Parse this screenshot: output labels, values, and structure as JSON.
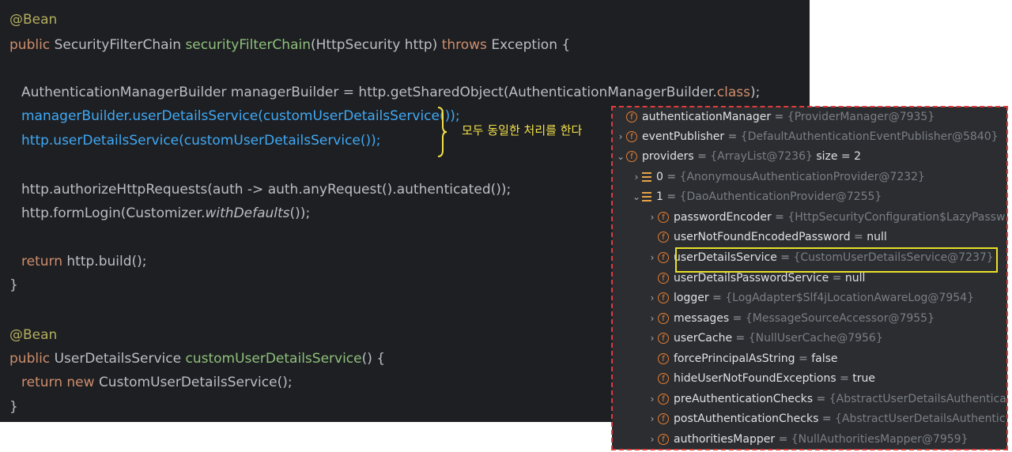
{
  "code": {
    "l1": "@Bean",
    "l2": {
      "kw1": "public",
      "type": "SecurityFilterChain",
      "fn": "securityFilterChain",
      "args": "(HttpSecurity http)",
      "kw2": "throws",
      "rest": "Exception {"
    },
    "l3": {
      "a": "AuthenticationManagerBuilder managerBuilder = http.getSharedObject(AuthenticationManagerBuilder.",
      "kw": "class",
      "b": ");"
    },
    "l4": "managerBuilder.userDetailsService(customUserDetailsService());",
    "l5": "http.userDetailsService(customUserDetailsService());",
    "l6": "http.authorizeHttpRequests(auth -> auth.anyRequest().authenticated());",
    "l7": {
      "a": "http.formLogin(Customizer.",
      "it": "withDefaults",
      "b": "());"
    },
    "l8": {
      "kw": "return",
      "rest": " http.build();"
    },
    "l9": "}",
    "l10": "@Bean",
    "l11": {
      "kw1": "public",
      "type": "UserDetailsService",
      "fn": "customUserDetailsService",
      "rest": "() {"
    },
    "l12": {
      "kw1": "return",
      "kw2": "new",
      "rest": "CustomUserDetailsService();"
    },
    "l13": "}"
  },
  "note": "모두 동일한 처리를 한다",
  "debugger": [
    {
      "name": "authenticationManager",
      "value": "{ProviderManager@7935}"
    },
    {
      "name": "eventPublisher",
      "value": "{DefaultAuthenticationEventPublisher@5840}"
    },
    {
      "name": "providers",
      "value": "{ArrayList@7236}",
      "extra": "size = 2"
    },
    {
      "name": "0",
      "value": "{AnonymousAuthenticationProvider@7232}"
    },
    {
      "name": "1",
      "value": "{DaoAuthenticationProvider@7255}"
    },
    {
      "name": "passwordEncoder",
      "value": "{HttpSecurityConfiguration$LazyPasswordEncoder"
    },
    {
      "name": "userNotFoundEncodedPassword",
      "value": "null"
    },
    {
      "name": "userDetailsService",
      "value": "{CustomUserDetailsService@7237}"
    },
    {
      "name": "userDetailsPasswordService",
      "value": "null"
    },
    {
      "name": "logger",
      "value": "{LogAdapter$Slf4jLocationAwareLog@7954}"
    },
    {
      "name": "messages",
      "value": "{MessageSourceAccessor@7955}"
    },
    {
      "name": "userCache",
      "value": "{NullUserCache@7956}"
    },
    {
      "name": "forcePrincipalAsString",
      "value": "false"
    },
    {
      "name": "hideUserNotFoundExceptions",
      "value": "true"
    },
    {
      "name": "preAuthenticationChecks",
      "value": "{AbstractUserDetailsAuthenticationProvider"
    },
    {
      "name": "postAuthenticationChecks",
      "value": "{AbstractUserDetailsAuthenticationProvider"
    },
    {
      "name": "authoritiesMapper",
      "value": "{NullAuthoritiesMapper@7959}"
    }
  ],
  "eq": "=",
  "colors": {
    "highlight": "#e8e02a",
    "dashed_border": "#e23b3b",
    "note": "#f2e14a"
  }
}
